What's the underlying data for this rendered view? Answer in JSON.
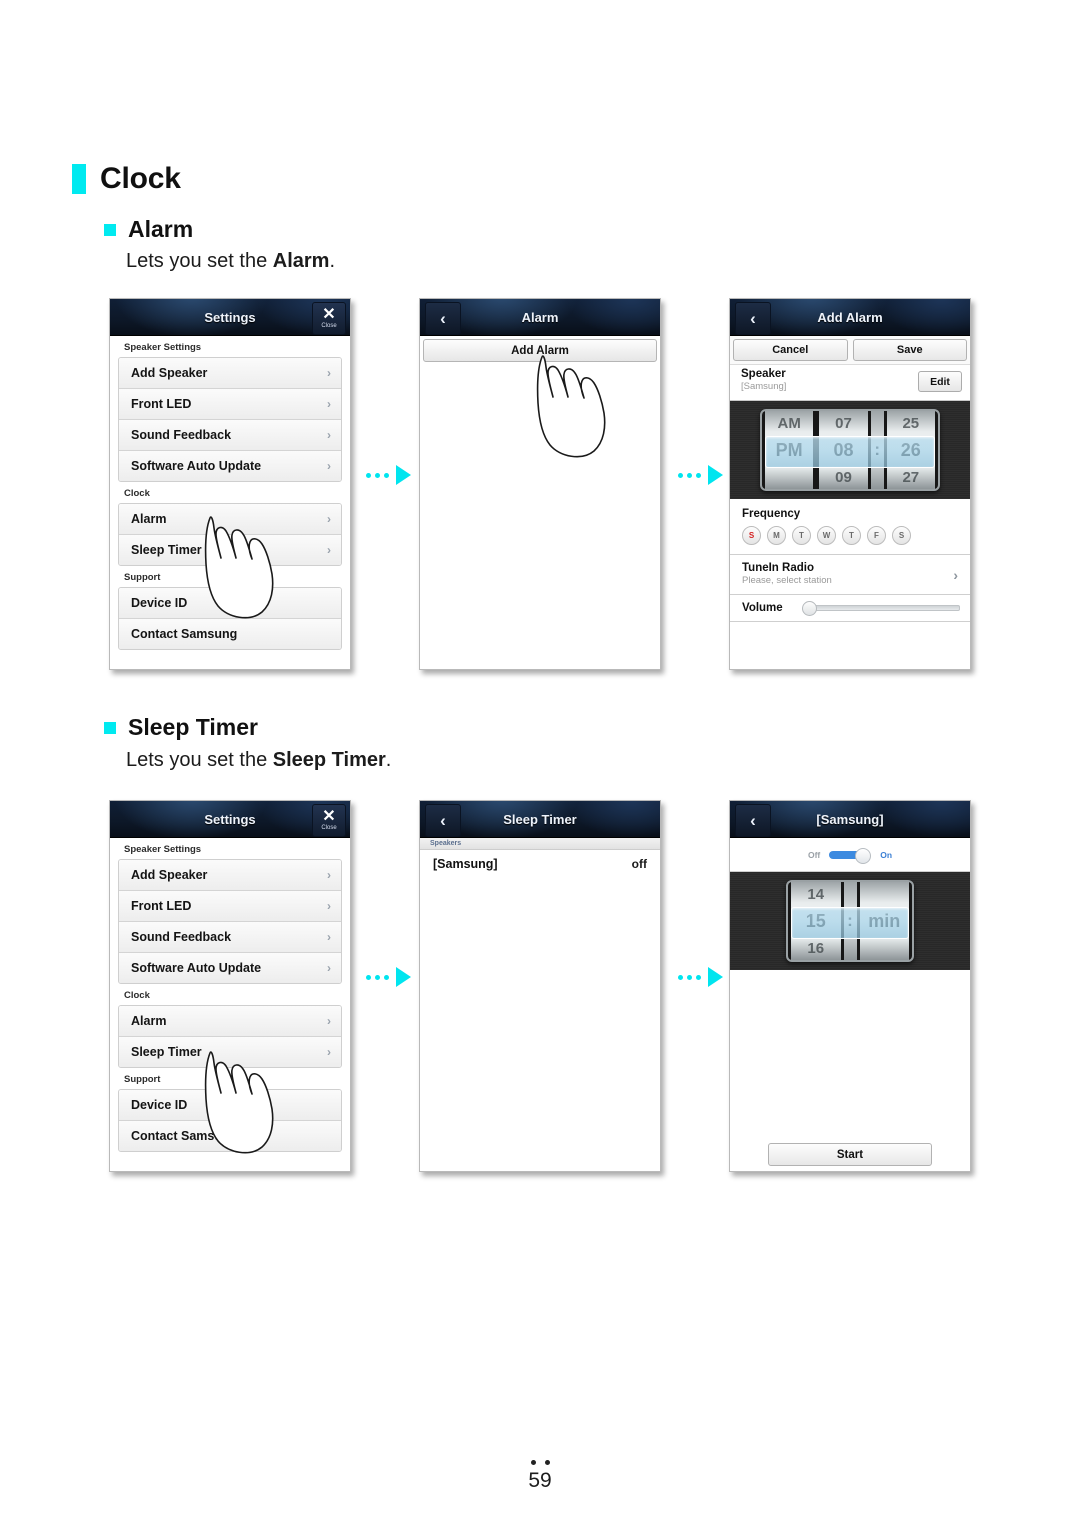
{
  "doc": {
    "page_number": "59",
    "section_title": "Clock",
    "subsections": [
      {
        "heading": "Alarm",
        "description_prefix": "Lets you set the ",
        "description_bold": "Alarm",
        "description_suffix": "."
      },
      {
        "heading": "Sleep Timer",
        "description_prefix": "Lets you set the ",
        "description_bold": "Sleep Timer",
        "description_suffix": "."
      }
    ]
  },
  "colors": {
    "accent": "#00eaf0",
    "arrow": "#00e5ef",
    "titlebar_dark": "#0d1828",
    "sunday_red": "#d41f1f",
    "toggle_blue": "#3c8ae0"
  },
  "settings_screen": {
    "title": "Settings",
    "close_icon": "close-icon",
    "close_label": "Close",
    "groups": [
      {
        "header": "Speaker Settings",
        "items": [
          "Add Speaker",
          "Front LED",
          "Sound Feedback",
          "Software Auto Update"
        ]
      },
      {
        "header": "Clock",
        "items": [
          "Alarm",
          "Sleep Timer"
        ]
      },
      {
        "header": "Support",
        "items": [
          "Device ID",
          "Contact Samsung"
        ]
      }
    ]
  },
  "alarm_screen": {
    "title": "Alarm",
    "back_icon": "chevron-left-icon",
    "add_alarm_label": "Add Alarm"
  },
  "add_alarm_screen": {
    "title": "Add Alarm",
    "back_icon": "chevron-left-icon",
    "cancel_label": "Cancel",
    "save_label": "Save",
    "speaker_label": "Speaker",
    "speaker_value": "[Samsung]",
    "edit_label": "Edit",
    "time_picker": {
      "meridiem": {
        "above": "AM",
        "selected": "PM",
        "below": ""
      },
      "hour": {
        "above": "07",
        "selected": "08",
        "below": "09"
      },
      "separator": ":",
      "minute": {
        "above": "25",
        "selected": "26",
        "below": "27"
      }
    },
    "frequency_label": "Frequency",
    "frequency_days": [
      {
        "label": "S",
        "sunday": true
      },
      {
        "label": "M",
        "sunday": false
      },
      {
        "label": "T",
        "sunday": false
      },
      {
        "label": "W",
        "sunday": false
      },
      {
        "label": "T",
        "sunday": false
      },
      {
        "label": "F",
        "sunday": false
      },
      {
        "label": "S",
        "sunday": false
      }
    ],
    "tunein_title": "TuneIn Radio",
    "tunein_subtitle": "Please, select station",
    "tunein_chevron": "chevron-right-icon",
    "volume_label": "Volume"
  },
  "sleep_timer_screen": {
    "title": "Sleep Timer",
    "back_icon": "chevron-left-icon",
    "list_header": "Speakers",
    "rows": [
      {
        "name": "[Samsung]",
        "status": "off"
      }
    ]
  },
  "samsung_timer_screen": {
    "title": "[Samsung]",
    "back_icon": "chevron-left-icon",
    "toggle_off_label": "Off",
    "toggle_on_label": "On",
    "toggle_state": "On",
    "minute_picker": {
      "value": {
        "above": "14",
        "selected": "15",
        "below": "16"
      },
      "separator": ":",
      "unit": "min"
    },
    "start_label": "Start"
  }
}
